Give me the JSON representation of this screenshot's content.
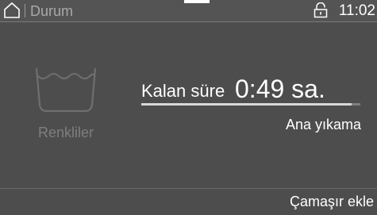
{
  "status_bar": {
    "home_icon": "home-icon",
    "title": "Durum",
    "lock_icon": "unlocked-padlock-icon",
    "time": "11:02"
  },
  "program": {
    "icon": "wash-tub-icon",
    "name": "Renkliler"
  },
  "remaining": {
    "label": "Kalan süre",
    "value": "0:49 sa.",
    "progress_fraction": 0.96,
    "phase": "Ana yıkama"
  },
  "actions": {
    "add_laundry_label": "Çamaşır ekle"
  },
  "colors": {
    "background": "#4d4d4d",
    "statusbar": "#545454",
    "text_primary": "#ffffff",
    "text_muted": "#7f7f7f",
    "progress_fill": "#d8d8d8",
    "progress_track": "#7f7f7f"
  }
}
